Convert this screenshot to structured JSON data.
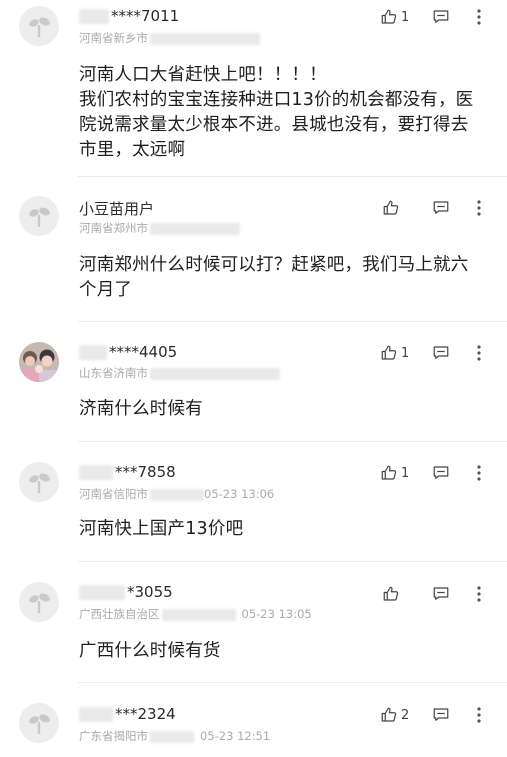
{
  "comments": [
    {
      "username_suffix": "****7011",
      "location": "河南省新乡市",
      "time": "",
      "likes": "1",
      "text": "河南人口大省赶快上吧！！！！\n我们农村的宝宝连接种进口13价的机会都没有，医院说需求量太少根本不进。县城也没有，要打得去市里，太远啊",
      "avatar": "default"
    },
    {
      "username_suffix": "小豆苗用户",
      "location": "河南省郑州市",
      "time": "",
      "likes": "",
      "text": "河南郑州什么时候可以打？赶紧吧，我们马上就六个月了",
      "avatar": "default"
    },
    {
      "username_suffix": "****4405",
      "location": "山东省济南市",
      "time": "",
      "likes": "1",
      "text": "济南什么时候有",
      "avatar": "photo"
    },
    {
      "username_suffix": "***7858",
      "location": "河南省信阳市",
      "time": "05-23 13:06",
      "likes": "1",
      "text": "河南快上国产13价吧",
      "avatar": "default"
    },
    {
      "username_suffix": "*3055",
      "location": "广西壮族自治区",
      "time": "05-23 13:05",
      "likes": "",
      "text": "广西什么时候有货",
      "avatar": "default"
    },
    {
      "username_suffix": "***2324",
      "location": "广东省揭阳市",
      "time": "05-23 12:51",
      "likes": "2",
      "text": "",
      "avatar": "default"
    }
  ],
  "icons": {
    "like": "thumbs-up-icon",
    "reply": "comment-icon",
    "more": "more-vertical-icon",
    "avatar": "sprout-avatar-icon"
  },
  "colors": {
    "text": "#1e1e1e",
    "secondary": "#aaaaaa",
    "divider": "#ececec",
    "avatar_bg": "#ededed"
  }
}
